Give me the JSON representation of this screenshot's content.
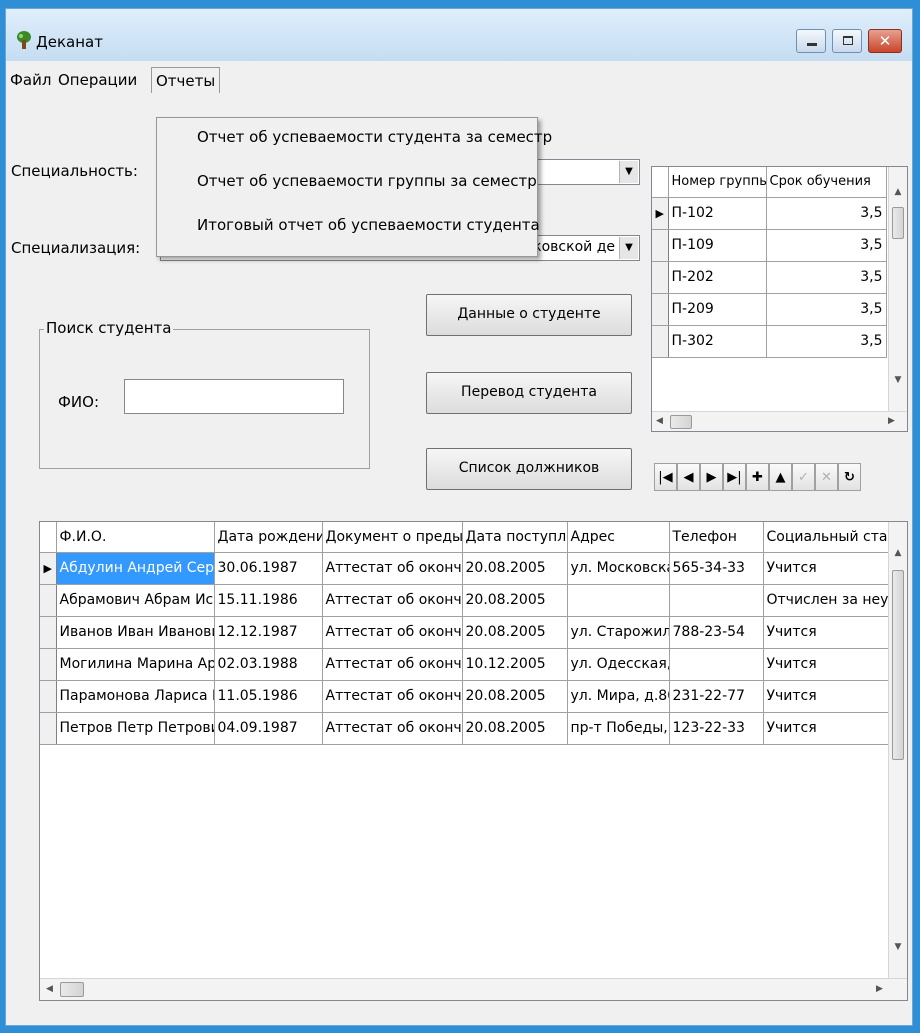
{
  "window": {
    "title": "Деканат"
  },
  "menu": [
    "Файл",
    "Операции",
    "Отчеты"
  ],
  "reports_menu": [
    "Отчет об успеваемости студента за семестр",
    "Отчет об успеваемости группы за семестр",
    "Итоговый отчет об успеваемости студента"
  ],
  "form": {
    "specialty_label": "Специальность:",
    "specialty_value": "",
    "specialization_label": "Специализация:",
    "specialization_value": "ковской де",
    "search_group": "Поиск студента",
    "fio_label": "ФИО:",
    "fio_value": ""
  },
  "buttons": {
    "student_data": "Данные о студенте",
    "transfer": "Перевод студента",
    "debtors": "Список должников"
  },
  "groups_table": {
    "columns": [
      "Номер группы",
      "Срок обучения"
    ],
    "rows": [
      [
        "П-102",
        "3,5"
      ],
      [
        "П-109",
        "3,5"
      ],
      [
        "П-202",
        "3,5"
      ],
      [
        "П-209",
        "3,5"
      ],
      [
        "П-302",
        "3,5"
      ]
    ]
  },
  "navigator": {
    "buttons": [
      {
        "name": "first-record-button",
        "glyph": "|◀"
      },
      {
        "name": "prior-record-button",
        "glyph": "◀"
      },
      {
        "name": "next-record-button",
        "glyph": "▶"
      },
      {
        "name": "last-record-button",
        "glyph": "▶|"
      },
      {
        "name": "insert-record-button",
        "glyph": "✚"
      },
      {
        "name": "delete-record-button",
        "glyph": "▲"
      },
      {
        "name": "post-edit-button",
        "glyph": "✓"
      },
      {
        "name": "cancel-edit-button",
        "glyph": "✕"
      },
      {
        "name": "refresh-button",
        "glyph": "↻"
      }
    ]
  },
  "students_table": {
    "columns": [
      "Ф.И.О.",
      "Дата рождения",
      "Документ о предыд",
      "Дата поступлен",
      "Адрес",
      "Телефон",
      "Социальный ста"
    ],
    "rows": [
      [
        "Абдулин Андрей Сергее",
        "30.06.1987",
        "Аттестат об окончан",
        "20.08.2005",
        "ул. Московска:",
        "565-34-33",
        "Учится"
      ],
      [
        "Абрамович Абрам Исак",
        "15.11.1986",
        "Аттестат об окончан",
        "20.08.2005",
        "",
        "",
        "Отчислен за неу"
      ],
      [
        "Иванов Иван Иванович",
        "12.12.1987",
        "Аттестат об окончан",
        "20.08.2005",
        "ул. Старожилов",
        "788-23-54",
        "Учится"
      ],
      [
        "Могилина Марина Артеі",
        "02.03.1988",
        "Аттестат об окончан",
        "10.12.2005",
        "ул. Одесская, д",
        "",
        "Учится"
      ],
      [
        "Парамонова Лариса Ма",
        "11.05.1986",
        "Аттестат об окончан",
        "20.08.2005",
        "ул. Мира, д.80,",
        "231-22-77",
        "Учится"
      ],
      [
        "Петров Петр Петрович",
        "04.09.1987",
        "Аттестат об окончан",
        "20.08.2005",
        "пр-т Победы, д",
        "123-22-33",
        "Учится"
      ]
    ]
  }
}
